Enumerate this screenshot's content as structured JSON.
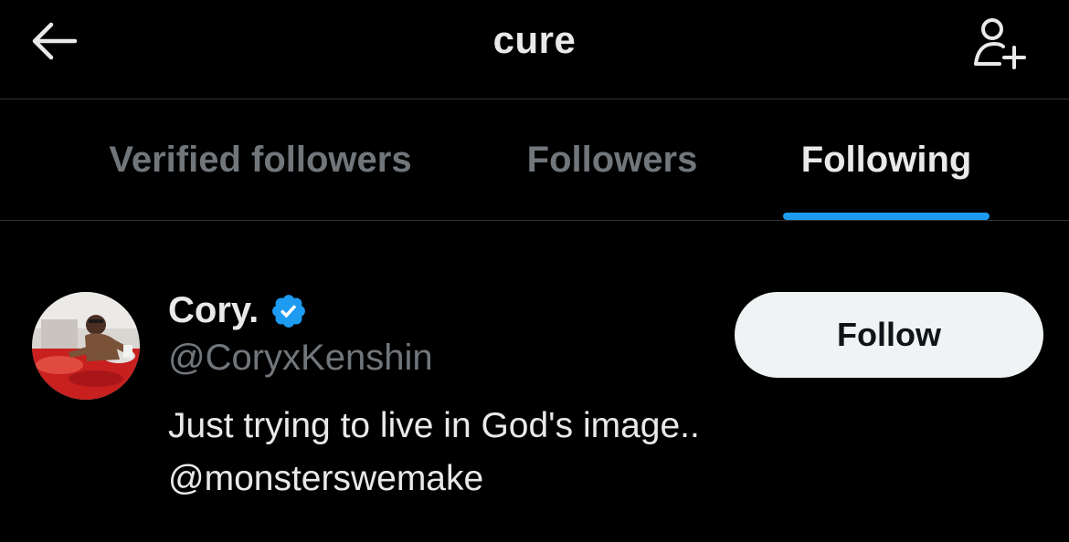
{
  "header": {
    "title": "cure",
    "back_icon": "arrow-left-icon",
    "add_icon": "add-user-icon"
  },
  "tabs": [
    {
      "label": "Verified followers",
      "active": false
    },
    {
      "label": "Followers",
      "active": false
    },
    {
      "label": "Following",
      "active": true
    }
  ],
  "user": {
    "display_name": "Cory.",
    "verified": true,
    "handle": "@CoryxKenshin",
    "bio_line1": "Just trying to live in God's image..",
    "bio_line2": "@monsterswemake",
    "follow_label": "Follow",
    "avatar_icon": "avatar-image"
  },
  "colors": {
    "background": "#000000",
    "primary_text": "#e7e9ea",
    "secondary_text": "#71767b",
    "accent": "#1d9bf0",
    "follow_bg": "#eff3f4"
  }
}
